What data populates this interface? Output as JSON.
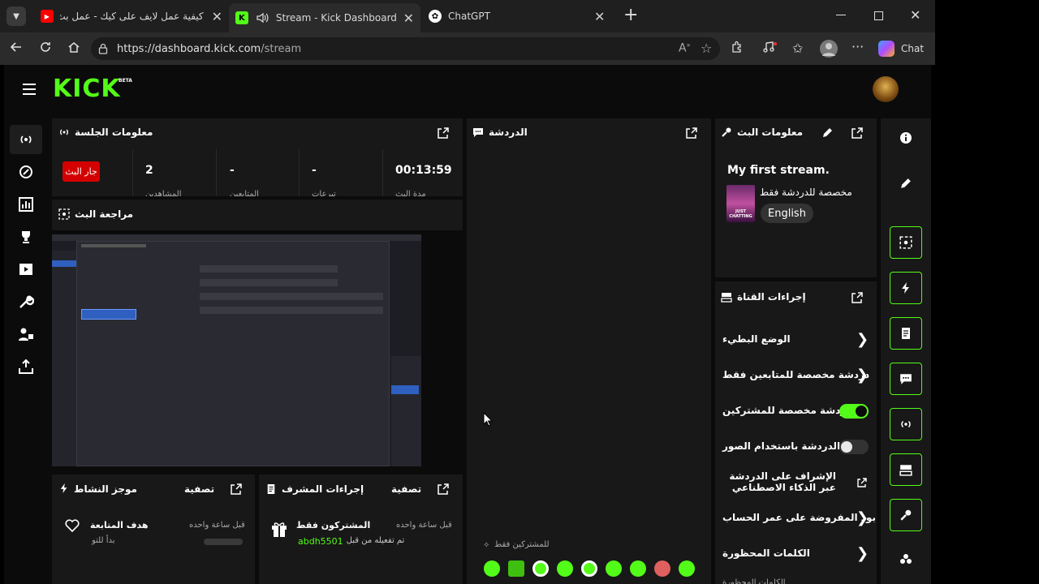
{
  "browser": {
    "tabs": [
      {
        "title": "كيفية عمل لايف على كيك - عمل بث",
        "favicon": "youtube-icon"
      },
      {
        "title": "Stream - Kick Dashboard",
        "favicon": "kick-icon",
        "active": true
      },
      {
        "title": "ChatGPT",
        "favicon": "chatgpt-icon"
      }
    ],
    "url": {
      "host": "https://dashboard.kick.com",
      "path": "/stream"
    },
    "copilot_label": "Chat"
  },
  "header": {
    "logo": "KICK",
    "beta": "BETA"
  },
  "session": {
    "title": "معلومات الجلسة",
    "live_badge": "جار البث",
    "stats": [
      {
        "value": "2",
        "label": "المشاهدين"
      },
      {
        "value": "-",
        "label": "المتابعين"
      },
      {
        "value": "-",
        "label": "تبرعات"
      },
      {
        "value": "00:13:59",
        "label": "مدة البث"
      }
    ]
  },
  "preview": {
    "title": "مراجعة البث"
  },
  "chat": {
    "title": "الدردشة",
    "mode_note": "للمشتركين فقط"
  },
  "stream_info": {
    "title": "معلومات البث",
    "stream_title": "My first stream.",
    "category_line": "مخصصة للدردشة فقط",
    "language": "English",
    "thumb_text": "JUST CHATTING"
  },
  "channel_actions": {
    "title": "إجراءات القناة",
    "items": [
      {
        "label": "الوضع البطيء",
        "control": "chevron"
      },
      {
        "label": "دردشة مخصصة للمتابعين فقط",
        "control": "chevron"
      },
      {
        "label": "...دردشة مخصصة للمشتركين",
        "control": "toggle-on"
      },
      {
        "label": "...الدردشة باستخدام الصور",
        "control": "toggle-off"
      },
      {
        "label": "الإشراف على الدردشة عبر الذكاء الاصطناعي",
        "control": "external"
      },
      {
        "label": "بود المفروضة على عمر الحساب",
        "control": "chevron"
      },
      {
        "label": "الكلمات المحظورة",
        "control": "chevron"
      }
    ],
    "cut_text": "الكلمات المحظورة"
  },
  "activity": {
    "title": "موجز النشاط",
    "filter": "تصفية",
    "item": {
      "title": "هدف المتابعة",
      "sub": "بدأ للتو",
      "time": "قبل ساعة واحده"
    }
  },
  "mod_actions": {
    "title": "إجراءات المشرف",
    "filter": "تصفية",
    "item": {
      "title": "المشتركون فقط",
      "sub": "تم تفعيله من قبل",
      "user": "abdh5501",
      "time": "قبل ساعة واحده"
    }
  },
  "colors": {
    "accent": "#53fc18",
    "live_red": "#d40000",
    "panel": "#181818"
  }
}
